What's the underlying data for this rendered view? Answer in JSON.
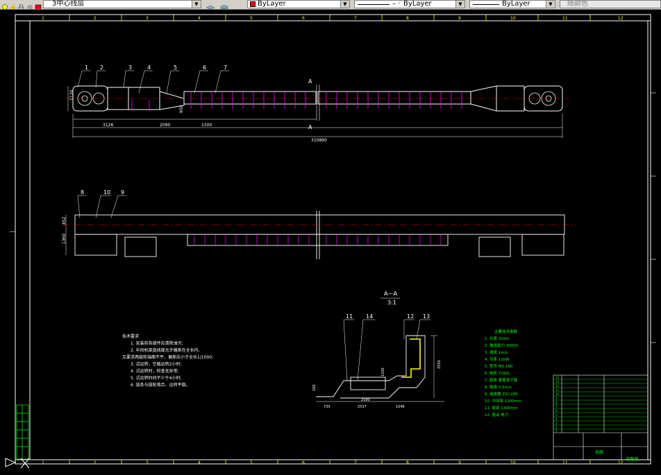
{
  "toolbar": {
    "layer_combo": {
      "value": "3中心线层"
    },
    "color_combo": {
      "value": "ByLayer",
      "swatch_color": "#ff0000"
    },
    "linetype_combo": {
      "value": "ByLayer"
    },
    "lineweight_combo": {
      "value": "ByLayer"
    },
    "plotstyle_combo": {
      "value": "随颜色"
    }
  },
  "drawing": {
    "ruler_top": [
      "1",
      "2",
      "3",
      "4",
      "5",
      "6",
      "7",
      "8",
      "9",
      "10",
      "11",
      "12"
    ],
    "ruler_bottom": [
      "1",
      "2",
      "3",
      "4",
      "5",
      "6",
      "7",
      "8",
      "9",
      "10",
      "11",
      "12"
    ],
    "top_view": {
      "balloons": [
        "1",
        "2",
        "3",
        "4",
        "5",
        "6",
        "7"
      ],
      "section_marker": "A",
      "dims": {
        "total": "310890",
        "d1": "3126",
        "d2": "2090",
        "d3": "1500",
        "height": "1120",
        "d4": "950"
      }
    },
    "front_view": {
      "balloons": [
        "8",
        "10",
        "9"
      ],
      "dims": {
        "h1": "452",
        "h2": "1360"
      }
    },
    "section": {
      "title": "A—A",
      "scale": "3:1",
      "balloons": [
        "11",
        "14",
        "12",
        "13"
      ],
      "dims": {
        "a": "730",
        "b": "2537",
        "c": "1048",
        "d": "2550",
        "e": "1200",
        "f": "2580",
        "g": "200"
      }
    },
    "notes": {
      "heading": "技术要求",
      "lines": [
        "1. 安装前各部件应清除油污;",
        "2. 中间机架直线度允许偏差在全长内,",
        "又要求两链轮端面不平，偏差应小于全长1/1000;",
        "3. 试运转，空载运转2小时;",
        "4. 试运转时，检查无异常;",
        "5. 试运转时间不少于4小时;",
        "6. 链条与链轮啮合，运转平稳。"
      ]
    },
    "specs": {
      "heading": "主要技术参数",
      "items": [
        "1. 长度 310m",
        "2. 输送能力 300t/h",
        "3. 速度 1m/s",
        "4. 功率 11kW",
        "5. 型号 MS-180",
        "6. 电机 Y160L",
        "7. 链条 套筒滚子链",
        "8. 链速 0.5m/s",
        "9. 减速器 ZSY-280",
        "10. 中间架 1200mm",
        "11. 尾架 1300mm",
        "12. 驱动 电力"
      ]
    },
    "title_block": {
      "name": "刮板机",
      "drawing_no": "总图",
      "rows": [
        "1",
        "2",
        "3",
        "4",
        "5",
        "6",
        "7",
        "8",
        "9",
        "10",
        "11",
        "12",
        "13",
        "14"
      ]
    }
  }
}
